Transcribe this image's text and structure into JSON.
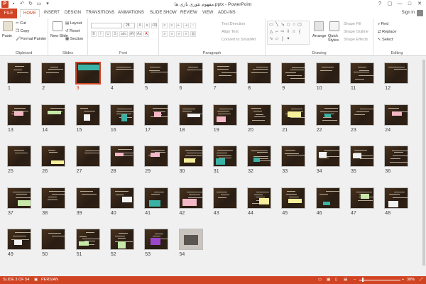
{
  "app": {
    "title": "مفهوم تئوری بازی ها.pptx - PowerPoint",
    "logo": "P",
    "accent": "#d04423"
  },
  "quick_access": {
    "save_icon": "save-icon",
    "undo_icon": "undo-icon",
    "redo_icon": "redo-icon",
    "start_icon": "start-presentation-icon"
  },
  "window_controls": [
    "?",
    "▢",
    "—",
    "□",
    "✕"
  ],
  "tabs": [
    "FILE",
    "HOME",
    "INSERT",
    "DESIGN",
    "TRANSITIONS",
    "ANIMATIONS",
    "SLIDE SHOW",
    "REVIEW",
    "VIEW",
    "ADD-INS"
  ],
  "active_tab": "HOME",
  "sign_in": "Sign in",
  "ribbon": {
    "clipboard": {
      "label": "Clipboard",
      "paste": "Paste",
      "cut": "Cut",
      "copy": "Copy",
      "format_painter": "Format Painter"
    },
    "slides": {
      "label": "Slides",
      "new_slide": "New Slide",
      "layout": "Layout",
      "reset": "Reset",
      "section": "Section"
    },
    "font": {
      "label": "Font",
      "font_size": "28",
      "buttons": [
        "B",
        "I",
        "U",
        "S",
        "abc",
        "AV",
        "Aa",
        "A"
      ]
    },
    "paragraph": {
      "label": "Paragraph",
      "text_direction": "Text Direction",
      "align_text": "Align Text",
      "smartart": "Convert to SmartArt"
    },
    "drawing": {
      "label": "Drawing",
      "arrange": "Arrange",
      "quick_styles": "Quick Styles",
      "shape_fill": "Shape Fill",
      "shape_outline": "Shape Outline",
      "shape_effects": "Shape Effects"
    },
    "editing": {
      "label": "Editing",
      "find": "Find",
      "replace": "Replace",
      "select": "Select"
    }
  },
  "slides": {
    "numbers": [
      "1",
      "2",
      "3",
      "4",
      "5",
      "6",
      "7",
      "8",
      "9",
      "10",
      "11",
      "12",
      "13",
      "14",
      "15",
      "16",
      "17",
      "18",
      "19",
      "20",
      "21",
      "22",
      "23",
      "24",
      "25",
      "26",
      "27",
      "28",
      "29",
      "30",
      "31",
      "32",
      "33",
      "34",
      "35",
      "36",
      "37",
      "38",
      "39",
      "40",
      "41",
      "42",
      "43",
      "44",
      "45",
      "46",
      "47",
      "48",
      "49",
      "50",
      "51",
      "52",
      "53",
      "54"
    ],
    "selected": 3,
    "total": 54
  },
  "status": {
    "slide_info": "SLIDE 3 OF 54",
    "language": "PERSIAN",
    "zoom": "38%"
  }
}
